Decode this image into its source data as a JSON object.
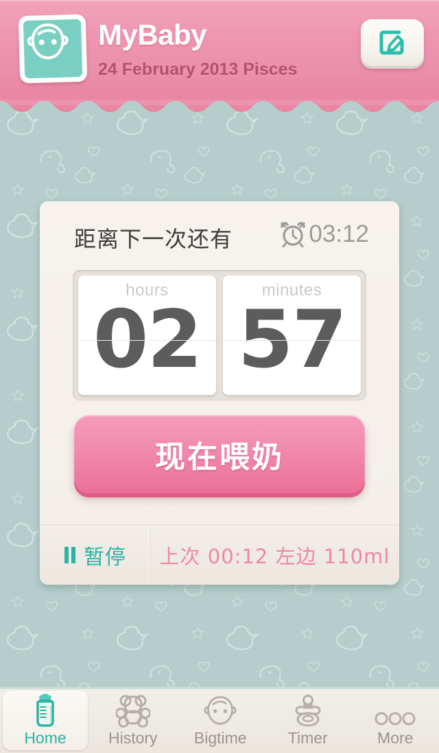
{
  "header": {
    "app_title": "MyBaby",
    "subtitle": "24 February 2013  Pisces",
    "app_icon_name": "baby-face-icon",
    "edit_icon_name": "edit-pencil-icon",
    "bg_color": "#ef96b1",
    "accent_teal": "#2bb3a3"
  },
  "card": {
    "countdown_label": "距离下一次还有",
    "alarm_icon_name": "alarm-clock-icon",
    "alarm_time": "03:12",
    "flip": [
      {
        "unit": "hours",
        "value": "02"
      },
      {
        "unit": "minutes",
        "value": "57"
      }
    ],
    "feed_button_label": "现在喂奶",
    "pause": {
      "icon_name": "pause-icon",
      "label": "暂停"
    },
    "last_feed": "上次 00:12 左边 110ml"
  },
  "tabbar": {
    "items": [
      {
        "label": "Home",
        "icon": "baby-bottle-icon",
        "active": true
      },
      {
        "label": "History",
        "icon": "teddy-bear-icon",
        "active": false
      },
      {
        "label": "Bigtime",
        "icon": "baby-face-icon",
        "active": false
      },
      {
        "label": "Timer",
        "icon": "pacifier-icon",
        "active": false
      },
      {
        "label": "More",
        "icon": "ellipsis-icon",
        "active": false
      }
    ]
  },
  "colors": {
    "background": "#b5cecb",
    "header_pink": "#ef96b1",
    "button_pink": "#f28cae",
    "teal": "#2bb3a3",
    "card_cream": "#f6f1ec",
    "digit_gray": "#5c5c5c",
    "muted_gray": "#9a948d"
  }
}
